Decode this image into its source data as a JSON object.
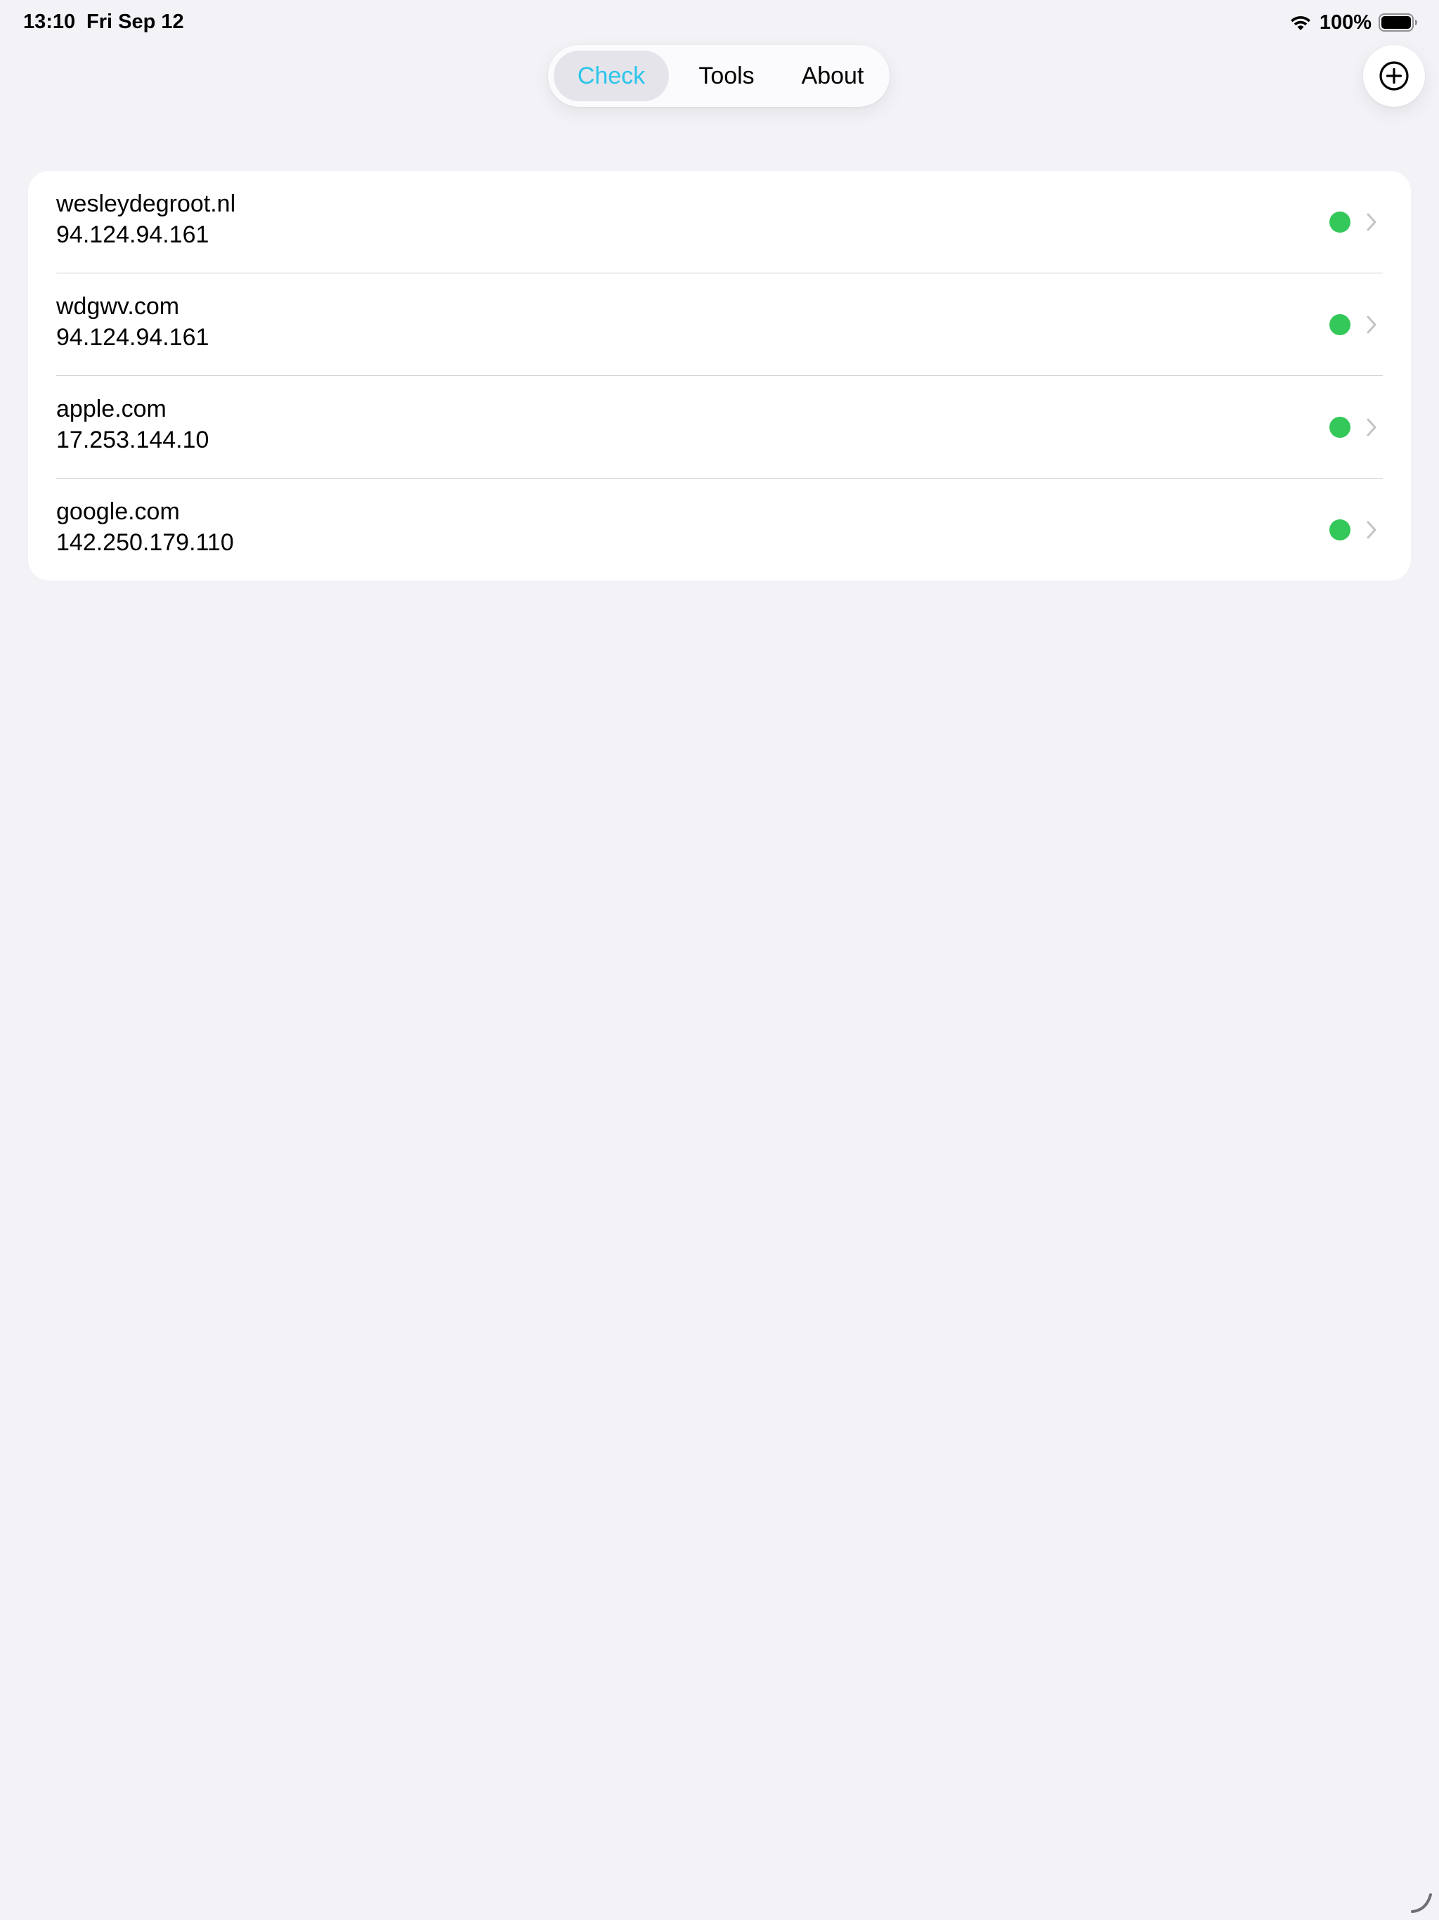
{
  "status_bar": {
    "time": "13:10",
    "date": "Fri Sep 12",
    "battery_percent": "100%",
    "icons": [
      "wifi-icon",
      "battery-icon"
    ]
  },
  "nav": {
    "tabs": [
      {
        "label": "Check",
        "selected": true
      },
      {
        "label": "Tools",
        "selected": false
      },
      {
        "label": "About",
        "selected": false
      }
    ],
    "add_button_icon": "plus-circle-icon"
  },
  "hosts": [
    {
      "host": "wesleydegroot.nl",
      "ip": "94.124.94.161",
      "status": "online"
    },
    {
      "host": "wdgwv.com",
      "ip": "94.124.94.161",
      "status": "online"
    },
    {
      "host": "apple.com",
      "ip": "17.253.144.10",
      "status": "online"
    },
    {
      "host": "google.com",
      "ip": "142.250.179.110",
      "status": "online"
    }
  ],
  "colors": {
    "background": "#f2f2f7",
    "accent": "#2cc5ea",
    "status_online": "#34c759",
    "chevron": "#c4c4c7"
  }
}
